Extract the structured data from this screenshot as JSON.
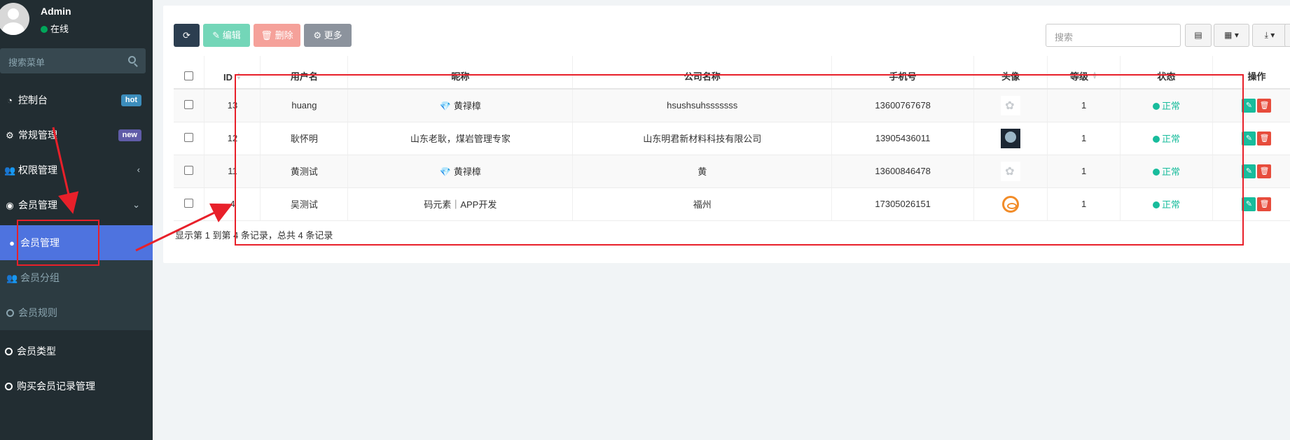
{
  "user": {
    "name": "Admin",
    "status": "在线"
  },
  "sidebar": {
    "search_placeholder": "搜索菜单",
    "items": [
      {
        "label": "控制台",
        "badge": "hot"
      },
      {
        "label": "常规管理",
        "badge": "new"
      },
      {
        "label": "权限管理",
        "arrow": "‹"
      },
      {
        "label": "会员管理",
        "arrow": "⌄"
      },
      {
        "label": "会员管理"
      },
      {
        "label": "会员分组"
      },
      {
        "label": "会员规则"
      },
      {
        "label": "会员类型"
      },
      {
        "label": "购买会员记录管理"
      }
    ]
  },
  "toolbar": {
    "edit_label": "编辑",
    "delete_label": "删除",
    "more_label": "更多",
    "search_placeholder": "搜索"
  },
  "table": {
    "headers": [
      "ID",
      "用户名",
      "昵称",
      "公司名称",
      "手机号",
      "头像",
      "等级",
      "状态",
      "操作"
    ],
    "rows": [
      {
        "id": "13",
        "username": "huang",
        "nickname": "黄禄樟",
        "company": "hsushsuhsssssss",
        "phone": "13600767678",
        "avatar": "flower",
        "level": "1",
        "status": "正常"
      },
      {
        "id": "12",
        "username": "耿怀明",
        "nickname": "山东老耿，煤岩管理专家",
        "company": "山东明君新材料科技有限公司",
        "phone": "13905436011",
        "avatar": "dark-photo",
        "level": "1",
        "status": "正常"
      },
      {
        "id": "11",
        "username": "黄测试",
        "nickname": "黄禄樟",
        "company": "黄",
        "phone": "13600846478",
        "avatar": "flower",
        "level": "1",
        "status": "正常"
      },
      {
        "id": "4",
        "username": "吴测试",
        "nickname": "码元素｜APP开发",
        "company": "福州",
        "phone": "17305026151",
        "avatar": "orange-logo",
        "level": "1",
        "status": "正常"
      }
    ],
    "summary": "显示第 1 到第 4 条记录，总共 4 条记录"
  },
  "colors": {
    "sidebar_bg": "#222d32",
    "active_menu": "#4e73df",
    "status_green": "#18bc9c",
    "annotation_red": "#e8202a"
  }
}
